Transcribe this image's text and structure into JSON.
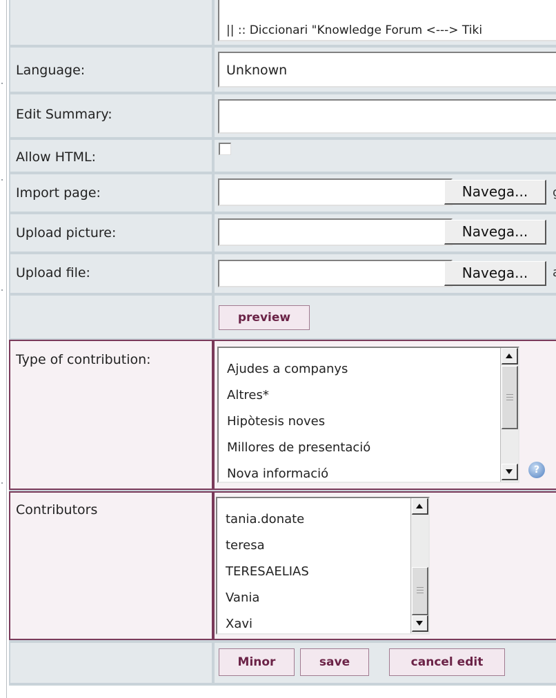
{
  "title_row": {
    "text": "|| ::   Diccionari \"Knowledge Forum <---> Tiki"
  },
  "fields": {
    "language": {
      "label": "Language:",
      "value": "Unknown"
    },
    "edit_summary": {
      "label": "Edit Summary:",
      "value": ""
    },
    "allow_html": {
      "label": "Allow HTML:",
      "checked": false
    },
    "import_page": {
      "label": "Import page:",
      "button": "Navega...",
      "value": ""
    },
    "upload_picture": {
      "label": "Upload picture:",
      "button": "Navega...",
      "value": ""
    },
    "upload_file": {
      "label": "Upload file:",
      "button": "Navega...",
      "value": ""
    }
  },
  "preview_button": "preview",
  "type_of_contribution": {
    "label": "Type of contribution:",
    "options": [
      "Ajudes a companys",
      "Altres*",
      "Hipòtesis noves",
      "Millores de presentació",
      "Nova informació"
    ]
  },
  "contributors": {
    "label": "Contributors",
    "options": [
      "tania.donate",
      "teresa",
      "TERESAELIAS",
      "Vania",
      "Xavi"
    ]
  },
  "actions": {
    "minor": "Minor",
    "save": "save",
    "cancel": "cancel edit"
  },
  "help_icon": {
    "glyph": "?"
  },
  "colors": {
    "accent": "#6b2347",
    "cell_bg": "#e4e9ec",
    "frame": "#c9d3d9",
    "pink_border": "#7a3a5a"
  }
}
